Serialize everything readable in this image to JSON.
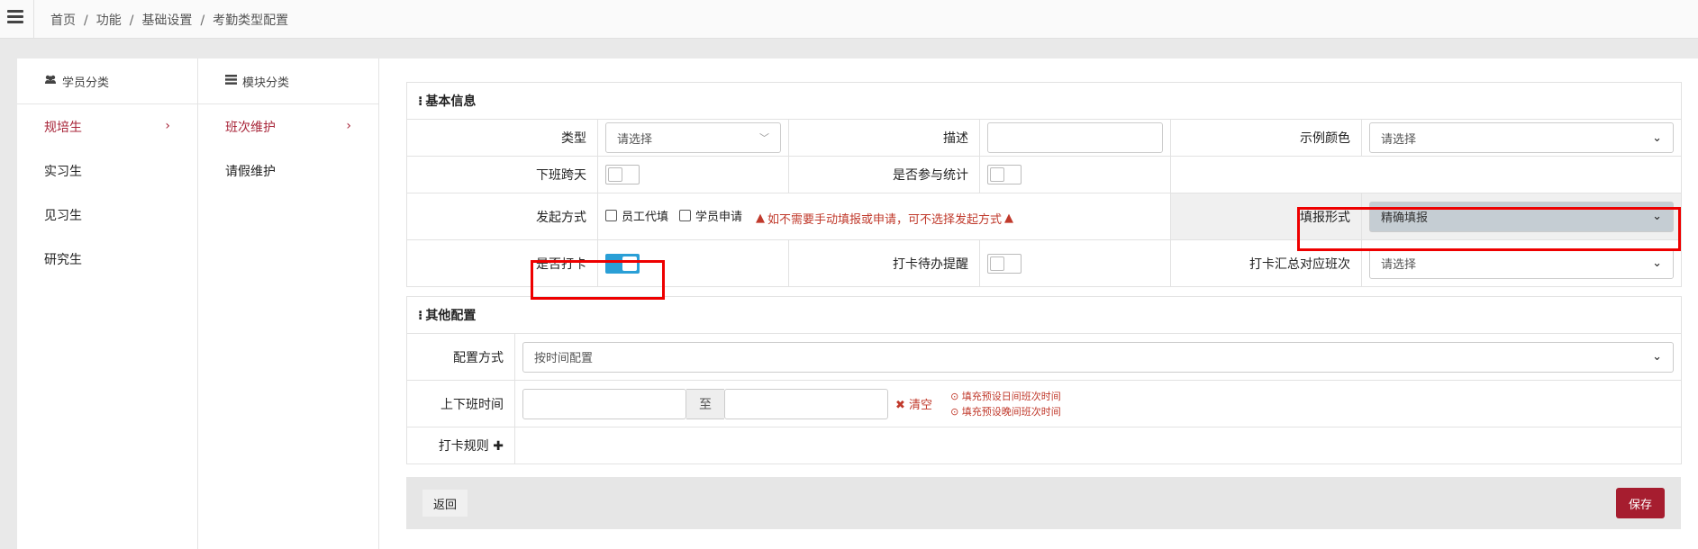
{
  "breadcrumb": [
    "首页",
    "功能",
    "基础设置",
    "考勤类型配置"
  ],
  "col1": {
    "header": "学员分类",
    "items": [
      "规培生",
      "实习生",
      "见习生",
      "研究生"
    ]
  },
  "col2": {
    "header": "模块分类",
    "items": [
      "班次维护",
      "请假维护"
    ]
  },
  "basic": {
    "title": "基本信息",
    "type_label": "类型",
    "type_value": "请选择",
    "desc_label": "描述",
    "desc_value": "",
    "color_label": "示例颜色",
    "color_value": "请选择",
    "crossday_label": "下班跨天",
    "stats_label": "是否参与统计",
    "initiate_label": "发起方式",
    "cb_staff": "员工代填",
    "cb_student": "学员申请",
    "warning": "如不需要手动填报或申请，可不选择发起方式",
    "fill_label": "填报形式",
    "fill_value": "精确填报",
    "clock_label": "是否打卡",
    "reminder_label": "打卡待办提醒",
    "summary_label": "打卡汇总对应班次",
    "summary_value": "请选择"
  },
  "other": {
    "title": "其他配置",
    "method_label": "配置方式",
    "method_value": "按时间配置",
    "time_label": "上下班时间",
    "to_text": "至",
    "clear": "清空",
    "hint_day": "填充预设日间班次时间",
    "hint_night": "填充预设晚间班次时间",
    "rule_label": "打卡规则"
  },
  "footer": {
    "back": "返回",
    "save": "保存"
  },
  "colors": {
    "accent": "#a8263a",
    "toggle_on": "#2a9fd6",
    "warning": "#c0392b",
    "save_bg": "#a61d2f"
  }
}
